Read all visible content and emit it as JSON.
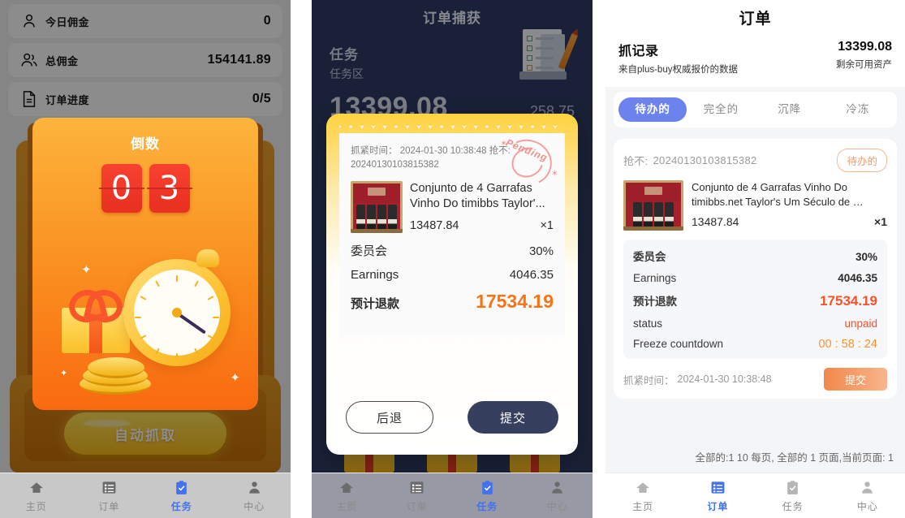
{
  "panel1": {
    "stats": [
      {
        "icon": "person-icon",
        "label": "今日佣金",
        "value": "0"
      },
      {
        "icon": "people-icon",
        "label": "总佣金",
        "value": "154141.89"
      },
      {
        "icon": "document-icon",
        "label": "订单进度",
        "value": "0/5"
      }
    ],
    "countdown": {
      "title": "倒数",
      "digit1": "0",
      "digit2": "3"
    },
    "auto_grab_label": "自动抓取",
    "nav": [
      {
        "icon": "home-icon",
        "label": "主页",
        "active": false
      },
      {
        "icon": "list-icon",
        "label": "订单",
        "active": false
      },
      {
        "icon": "clipboard-check-icon",
        "label": "任务",
        "active": true
      },
      {
        "icon": "user-icon",
        "label": "中心",
        "active": false
      }
    ]
  },
  "panel2": {
    "title": "订单捕获",
    "task_label": "任务",
    "task_zone": "任务区",
    "amount": "13399.08",
    "sub_amount": "258.75",
    "receipt": {
      "meta_line1": "抓紧时间： 2024-01-30 10:38:48 抢不:",
      "meta_line2": "20240130103815382",
      "stamp": "Pending",
      "product_name": "Conjunto de 4 Garrafas Vinho Do timibbs Taylor'...",
      "price": "13487.84",
      "qty": "×1",
      "rows": [
        {
          "key": "委员会",
          "value": "30%"
        },
        {
          "key": "Earnings",
          "value": "4046.35"
        }
      ],
      "refund_key": "预计退款",
      "refund_value": "17534.19"
    },
    "back_label": "后退",
    "submit_label": "提交",
    "nav": [
      {
        "icon": "home-icon",
        "label": "主页",
        "active": false
      },
      {
        "icon": "list-icon",
        "label": "订单",
        "active": false
      },
      {
        "icon": "clipboard-check-icon",
        "label": "任务",
        "active": true
      },
      {
        "icon": "user-icon",
        "label": "中心",
        "active": false
      }
    ]
  },
  "panel3": {
    "title": "订单",
    "summary": {
      "left_title": "抓记录",
      "left_sub": "来自plus-buy权威报价的数据",
      "right_value": "13399.08",
      "right_sub": "剩余可用资产"
    },
    "tabs": [
      {
        "label": "待办的",
        "active": true
      },
      {
        "label": "完全的",
        "active": false
      },
      {
        "label": "沉降",
        "active": false
      },
      {
        "label": "冷冻",
        "active": false
      }
    ],
    "order": {
      "order_id_label": "抢不:",
      "order_id": "20240130103815382",
      "badge": "待办的",
      "product_name": "Conjunto de 4 Garrafas Vinho Do timibbs.net Taylor's Um Século de …",
      "price": "13487.84",
      "qty": "×1",
      "details": [
        {
          "key": "委员会",
          "value": "30%",
          "style": "normal"
        },
        {
          "key": "Earnings",
          "value": "4046.35",
          "style": "normal"
        },
        {
          "key": "预计退款",
          "value": "17534.19",
          "style": "refund"
        },
        {
          "key": "status",
          "value": "unpaid",
          "style": "status"
        },
        {
          "key": "Freeze countdown",
          "value": "00 : 58 : 24",
          "style": "freeze"
        }
      ],
      "footer_time_label": "抓紧时间：",
      "footer_time": "2024-01-30 10:38:48",
      "submit_label": "提交"
    },
    "pagination": "全部的:1 10 每页, 全部的 1 页面,当前页面: 1",
    "nav": [
      {
        "icon": "home-icon",
        "label": "主页",
        "active": false
      },
      {
        "icon": "list-icon",
        "label": "订单",
        "active": true
      },
      {
        "icon": "clipboard-check-icon",
        "label": "任务",
        "active": false
      },
      {
        "icon": "user-icon",
        "label": "中心",
        "active": false
      }
    ]
  },
  "colors": {
    "accent_blue": "#6c83ee",
    "accent_orange": "#f4512c",
    "panel2_bg": "#2e3a5e",
    "countdown_card": "#fa9422",
    "freeze_orange": "#f5942f"
  }
}
